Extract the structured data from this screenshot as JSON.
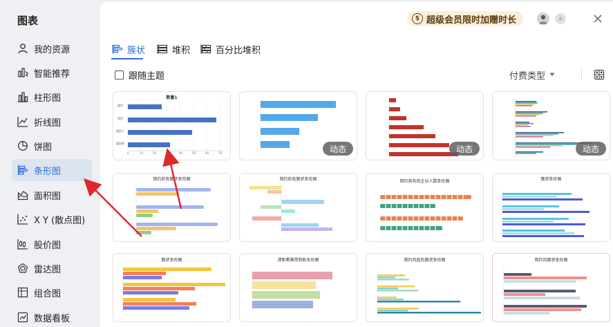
{
  "sidebar": {
    "title": "图表",
    "items": [
      {
        "label": "我的资源",
        "icon": "person-icon"
      },
      {
        "label": "智能推荐",
        "icon": "smart-recommend-icon"
      },
      {
        "label": "柱形图",
        "icon": "bar-chart-icon"
      },
      {
        "label": "折线图",
        "icon": "line-chart-icon"
      },
      {
        "label": "饼图",
        "icon": "pie-chart-icon"
      },
      {
        "label": "条形图",
        "icon": "horizontal-bar-chart-icon",
        "active": true
      },
      {
        "label": "面积图",
        "icon": "area-chart-icon"
      },
      {
        "label": "X Y (散点图)",
        "icon": "scatter-chart-icon"
      },
      {
        "label": "股价图",
        "icon": "stock-chart-icon"
      },
      {
        "label": "雷达图",
        "icon": "radar-chart-icon"
      },
      {
        "label": "组合图",
        "icon": "combo-chart-icon"
      },
      {
        "label": "数据看板",
        "icon": "dashboard-icon"
      }
    ]
  },
  "header": {
    "vip_text": "超级会员限时加赠时长",
    "vip_icon": "coin-icon"
  },
  "tabs": [
    {
      "label": "簇状",
      "active": true
    },
    {
      "label": "堆积"
    },
    {
      "label": "百分比堆积"
    }
  ],
  "toolbar": {
    "follow_theme": "跟随主题",
    "pay_type": "付费类型"
  },
  "cards": [
    {
      "title": "数量1",
      "badge": "",
      "categories": [
        "类目",
        "项目",
        "类目三",
        "类目四"
      ],
      "ticks": [
        "0",
        "10",
        "20",
        "30",
        "40",
        "50",
        "60",
        "70",
        "80"
      ]
    },
    {
      "title": "",
      "badge": "动态"
    },
    {
      "title": "",
      "badge": "动态"
    },
    {
      "title": "",
      "badge": "动态"
    },
    {
      "title": "简约彩色簇状条形图",
      "badge": ""
    },
    {
      "title": "简约彩色簇状条形图",
      "badge": ""
    },
    {
      "title": "简约商务风企业人数条形图",
      "badge": ""
    },
    {
      "title": "簇状条形图",
      "badge": ""
    },
    {
      "title": "簇状条形图",
      "badge": ""
    },
    {
      "title": "清新素雅带阴影条形图",
      "badge": ""
    },
    {
      "title": "简约风蓝色簇状条形图",
      "badge": ""
    },
    {
      "title": "简约风簇状条形图",
      "badge": ""
    }
  ],
  "colors": {
    "accent": "#2b6fd6",
    "annotation_arrow": "#e0282c"
  }
}
